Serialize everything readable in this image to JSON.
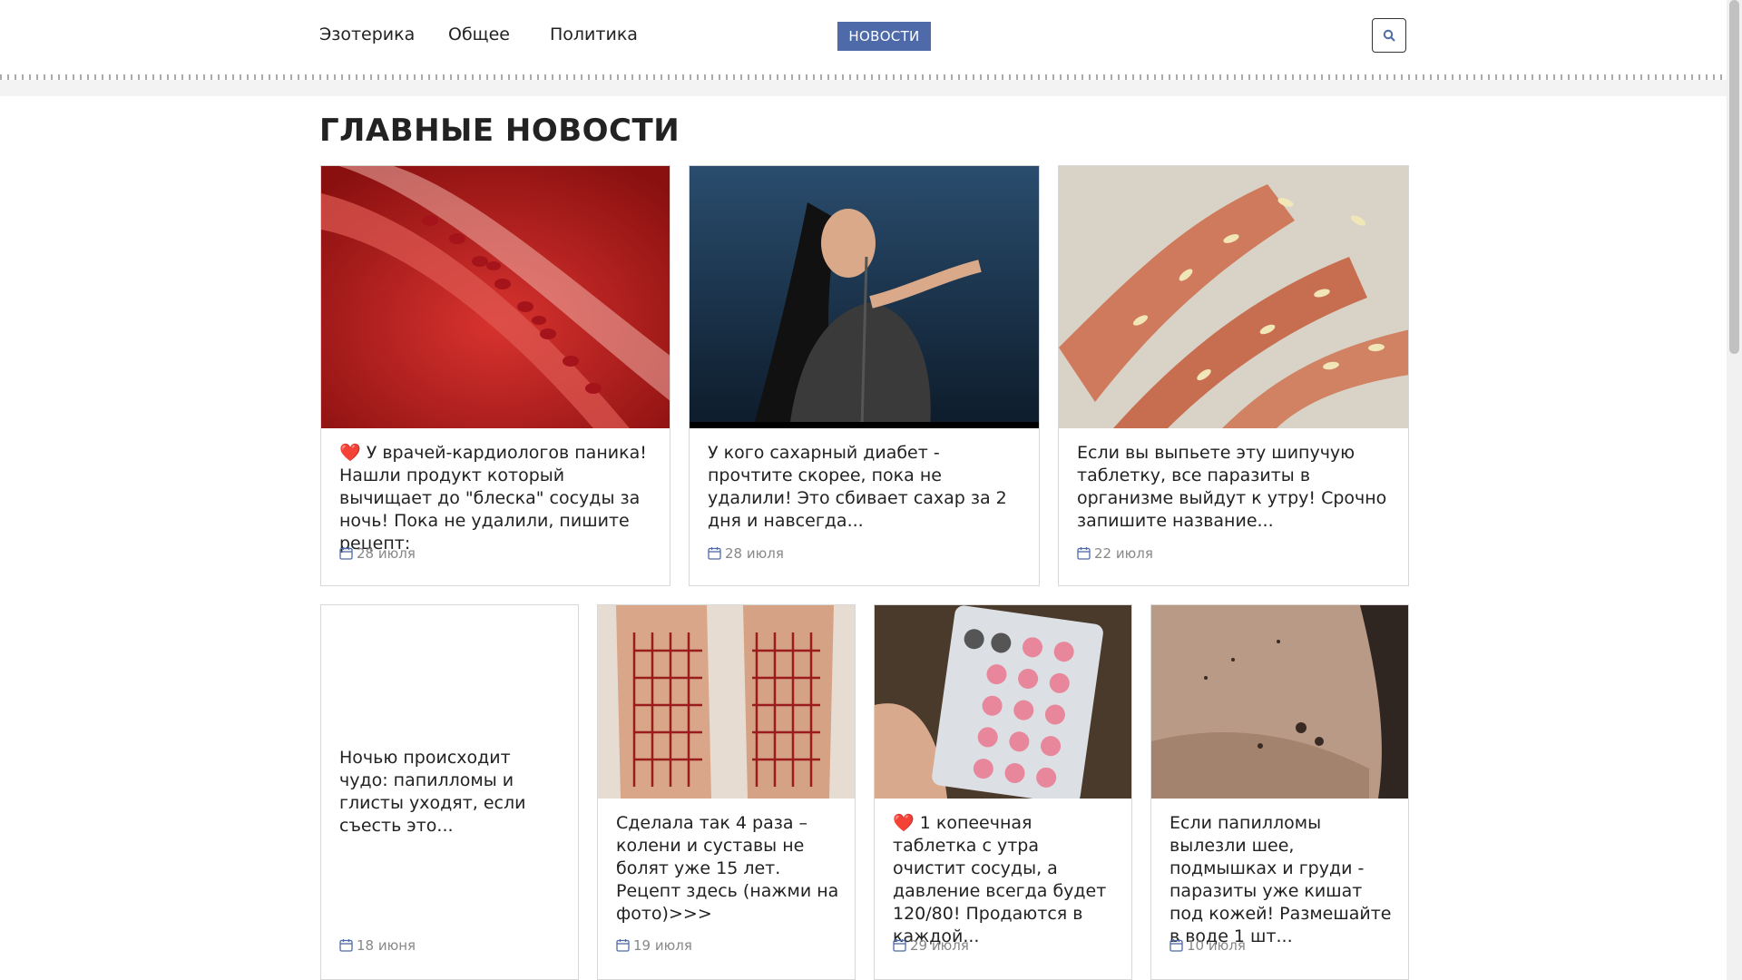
{
  "nav": {
    "items": [
      "Эзотерика",
      "Общее",
      "Политика"
    ],
    "news_button": "НОВОСТИ",
    "search_icon": "search-icon"
  },
  "page_title": "ГЛАВНЫЕ НОВОСТИ",
  "colors": {
    "accent": "#4e6aa8",
    "heart": "#e0262c",
    "date_icon": "#4e6aa8"
  },
  "cards": [
    {
      "heart": "❤️",
      "title": "У врачей-кардиологов паника! Нашли продукт который вычищает до \"блеска\" сосуды за ночь! Пока не удалили, пишите рецепт:",
      "date": "28 июля",
      "image": "blood-vessel-image"
    },
    {
      "heart": "",
      "title": "У кого сахарный диабет - прочтите скорее, пока не удалили! Это сбивает сахар за 2 дня и навсегда...",
      "date": "28 июля",
      "image": "singer-image"
    },
    {
      "heart": "",
      "title": "Если вы выпьете эту шипучую таблетку, все паразиты в организме выйдут к утру! Срочно запишите название...",
      "date": "22 июля",
      "image": "parasites-fingers-image"
    },
    {
      "heart": "",
      "title": "Ночью происходит чудо: папилломы и глисты уходят, если съесть это...",
      "date": "18 июня",
      "image": ""
    },
    {
      "heart": "",
      "title": "Сделала так 4 раза – колени и суставы не болят уже 15 лет. Рецепт здесь (нажми на фото)>>>",
      "date": "19 июля",
      "image": "knees-grid-image"
    },
    {
      "heart": "❤️",
      "title": "1 копеечная таблетка с утра очистит сосуды, а давление всегда будет 120/80! Продаются в каждой...",
      "date": "29 июля",
      "image": "pills-blister-image"
    },
    {
      "heart": "",
      "title": "Если папилломы вылезли шее, подмышках и груди - паразиты уже кишат под кожей! Размешайте в воде 1 шт...",
      "date": "10 июля",
      "image": "neck-papillomas-image"
    }
  ]
}
